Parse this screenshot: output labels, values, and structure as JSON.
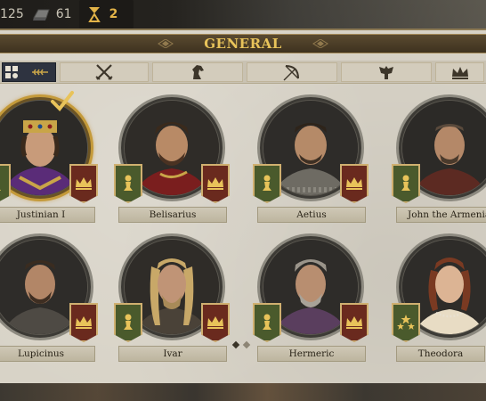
{
  "resources": [
    {
      "id": "troops",
      "value": "125",
      "icon": "troops-icon"
    },
    {
      "id": "iron",
      "value": "61",
      "icon": "iron-icon"
    },
    {
      "id": "medals",
      "value": "2",
      "icon": "medal-icon"
    }
  ],
  "panel": {
    "title": "GENERAL"
  },
  "tabs": [
    {
      "id": "all",
      "icon": "grid-filter-icon",
      "active": true
    },
    {
      "id": "infantry",
      "icon": "crossed-swords-icon",
      "active": false
    },
    {
      "id": "cavalry",
      "icon": "horse-head-icon",
      "active": false
    },
    {
      "id": "archer",
      "icon": "bow-icon",
      "active": false
    },
    {
      "id": "navy",
      "icon": "eagle-icon",
      "active": false
    },
    {
      "id": "royal",
      "icon": "crown-icon",
      "active": false
    }
  ],
  "generals": [
    {
      "name": "Justinian I",
      "selected": true,
      "left_badge": "pawn-icon",
      "right_badge": "crown-icon"
    },
    {
      "name": "Belisarius",
      "selected": false,
      "left_badge": "pawn-icon",
      "right_badge": "crown-icon"
    },
    {
      "name": "Aetius",
      "selected": false,
      "left_badge": "pawn-icon",
      "right_badge": "crown-icon"
    },
    {
      "name": "John the Armenian",
      "selected": false,
      "left_badge": "pawn-icon",
      "right_badge": "crown-icon"
    },
    {
      "name": "Lupicinus",
      "selected": false,
      "left_badge": "pawn-icon",
      "right_badge": "crown-icon"
    },
    {
      "name": "Ivar",
      "selected": false,
      "left_badge": "pawn-icon",
      "right_badge": "crown-icon"
    },
    {
      "name": "Hermeric",
      "selected": false,
      "left_badge": "pawn-icon",
      "right_badge": "crown-icon"
    },
    {
      "name": "Theodora",
      "selected": false,
      "left_badge": "stars-icon",
      "right_badge": "crown-icon"
    }
  ],
  "pagination": {
    "current": 1,
    "total": 2
  },
  "colors": {
    "gold": "#e8c35a",
    "panel": "#d8d3c7",
    "badge_green": "#4a5a2c",
    "badge_red": "#6a2a1e",
    "selected_ring": "#c49a3a"
  }
}
